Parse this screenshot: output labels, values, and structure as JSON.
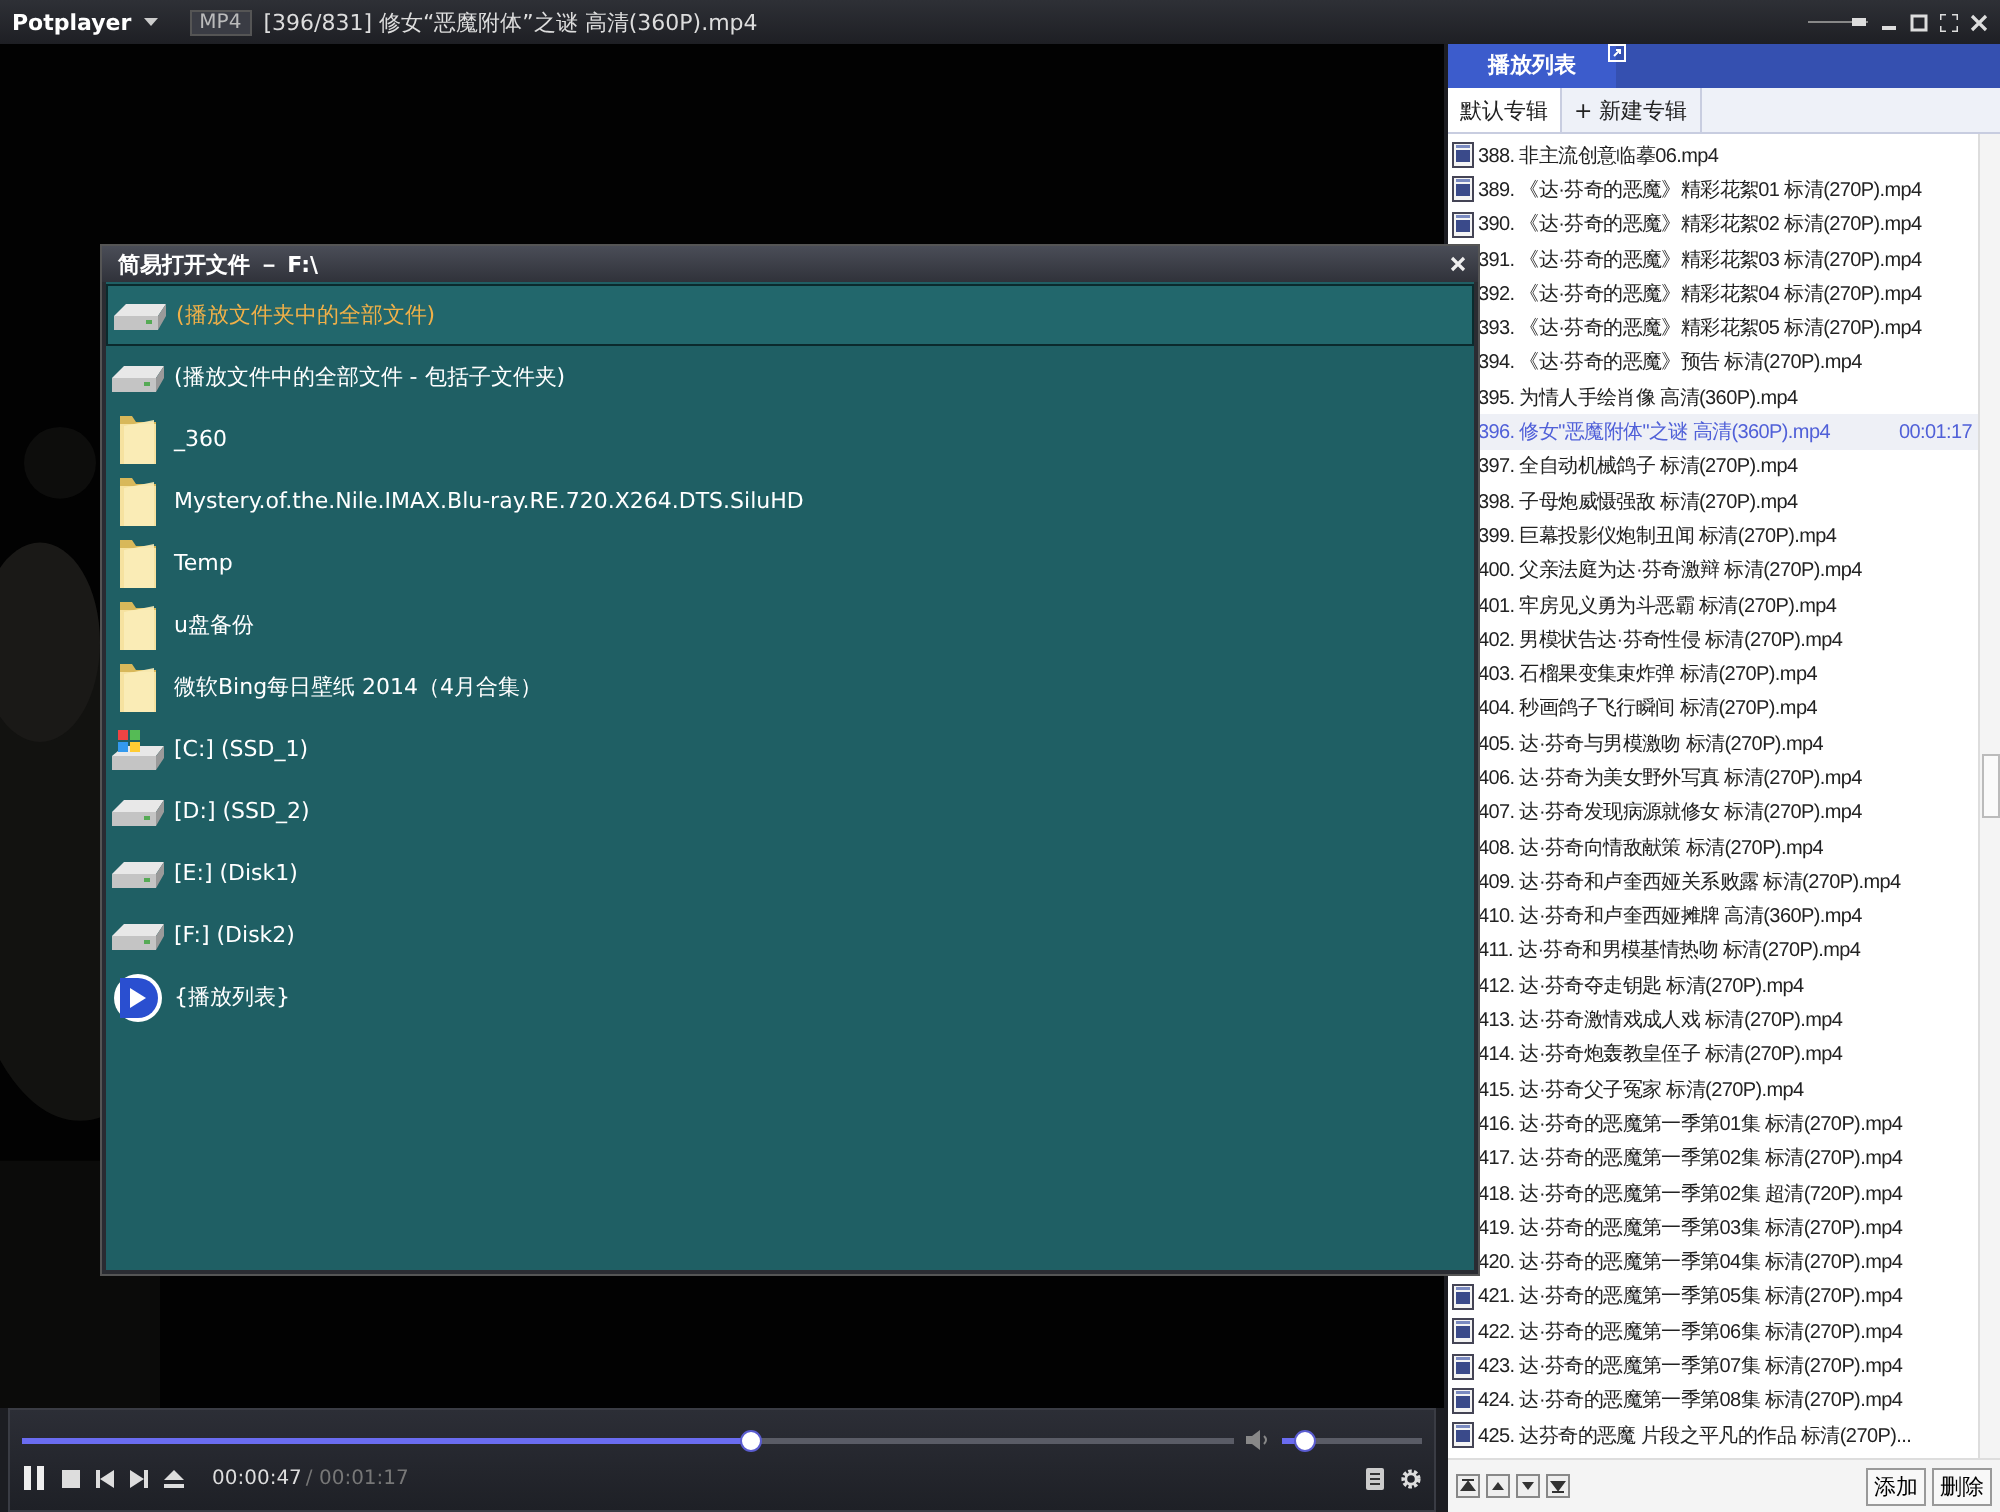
{
  "titlebar": {
    "logo": "Potplayer",
    "format": "MP4",
    "title": "[396/831] 修女“恶魔附体”之谜 高清(360P).mp4"
  },
  "playlist": {
    "title": "播放列表",
    "tabs": [
      {
        "label": "默认专辑",
        "selected": true
      },
      {
        "label": "+ 新建专辑",
        "selected": false
      }
    ],
    "rows": [
      {
        "text": "388. 非主流创意临摹06.mp4",
        "icon": true,
        "selected": false
      },
      {
        "text": "389. 《达·芬奇的恶魔》精彩花絮01 标清(270P).mp4",
        "icon": true,
        "selected": false
      },
      {
        "text": "390. 《达·芬奇的恶魔》精彩花絮02 标清(270P).mp4",
        "icon": true,
        "selected": false
      },
      {
        "text": "391. 《达·芬奇的恶魔》精彩花絮03 标清(270P).mp4",
        "icon": false,
        "selected": false
      },
      {
        "text": "392. 《达·芬奇的恶魔》精彩花絮04 标清(270P).mp4",
        "icon": false,
        "selected": false
      },
      {
        "text": "393. 《达·芬奇的恶魔》精彩花絮05 标清(270P).mp4",
        "icon": false,
        "selected": false
      },
      {
        "text": "394. 《达·芬奇的恶魔》预告 标清(270P).mp4",
        "icon": false,
        "selected": false
      },
      {
        "text": "395. 为情人手绘肖像 高清(360P).mp4",
        "icon": false,
        "selected": false
      },
      {
        "text": "396. 修女\"恶魔附体\"之谜 高清(360P).mp4",
        "duration": "00:01:17",
        "icon": false,
        "selected": true
      },
      {
        "text": "397. 全自动机械鸽子 标清(270P).mp4",
        "icon": false,
        "selected": false
      },
      {
        "text": "398. 子母炮威慑强敌 标清(270P).mp4",
        "icon": false,
        "selected": false
      },
      {
        "text": "399. 巨幕投影仪炮制丑闻 标清(270P).mp4",
        "icon": false,
        "selected": false
      },
      {
        "text": "400. 父亲法庭为达·芬奇激辩 标清(270P).mp4",
        "icon": false,
        "selected": false
      },
      {
        "text": "401. 牢房见义勇为斗恶霸 标清(270P).mp4",
        "icon": false,
        "selected": false
      },
      {
        "text": "402. 男模状告达·芬奇性侵 标清(270P).mp4",
        "icon": false,
        "selected": false
      },
      {
        "text": "403. 石榴果变集束炸弹 标清(270P).mp4",
        "icon": false,
        "selected": false
      },
      {
        "text": "404. 秒画鸽子飞行瞬间 标清(270P).mp4",
        "icon": false,
        "selected": false
      },
      {
        "text": "405. 达·芬奇与男模激吻 标清(270P).mp4",
        "icon": false,
        "selected": false
      },
      {
        "text": "406. 达·芬奇为美女野外写真 标清(270P).mp4",
        "icon": false,
        "selected": false
      },
      {
        "text": "407. 达·芬奇发现病源就修女 标清(270P).mp4",
        "icon": false,
        "selected": false
      },
      {
        "text": "408. 达·芬奇向情敌献策 标清(270P).mp4",
        "icon": false,
        "selected": false
      },
      {
        "text": "409. 达·芬奇和卢奎西娅关系败露 标清(270P).mp4",
        "icon": false,
        "selected": false
      },
      {
        "text": "410. 达·芬奇和卢奎西娅摊牌 高清(360P).mp4",
        "icon": false,
        "selected": false
      },
      {
        "text": "411. 达·芬奇和男模基情热吻 标清(270P).mp4",
        "icon": false,
        "selected": false
      },
      {
        "text": "412. 达·芬奇夺走钥匙 标清(270P).mp4",
        "icon": false,
        "selected": false
      },
      {
        "text": "413. 达·芬奇激情戏成人戏 标清(270P).mp4",
        "icon": false,
        "selected": false
      },
      {
        "text": "414. 达·芬奇炮轰教皇侄子 标清(270P).mp4",
        "icon": false,
        "selected": false
      },
      {
        "text": "415. 达·芬奇父子冤家 标清(270P).mp4",
        "icon": false,
        "selected": false
      },
      {
        "text": "416. 达·芬奇的恶魔第一季第01集 标清(270P).mp4",
        "icon": false,
        "selected": false
      },
      {
        "text": "417. 达·芬奇的恶魔第一季第02集 标清(270P).mp4",
        "icon": false,
        "selected": false
      },
      {
        "text": "418. 达·芬奇的恶魔第一季第02集 超清(720P).mp4",
        "icon": false,
        "selected": false
      },
      {
        "text": "419. 达·芬奇的恶魔第一季第03集 标清(270P).mp4",
        "icon": false,
        "selected": false
      },
      {
        "text": "420. 达·芬奇的恶魔第一季第04集 标清(270P).mp4",
        "icon": false,
        "selected": false
      },
      {
        "text": "421. 达·芬奇的恶魔第一季第05集 标清(270P).mp4",
        "icon": true,
        "selected": false
      },
      {
        "text": "422. 达·芬奇的恶魔第一季第06集 标清(270P).mp4",
        "icon": true,
        "selected": false
      },
      {
        "text": "423. 达·芬奇的恶魔第一季第07集 标清(270P).mp4",
        "icon": true,
        "selected": false
      },
      {
        "text": "424. 达·芬奇的恶魔第一季第08集 标清(270P).mp4",
        "icon": true,
        "selected": false
      },
      {
        "text": "425. 达芬奇的恶魔 片段之平凡的作品 标清(270P)...",
        "icon": true,
        "selected": false
      }
    ],
    "buttons": [
      "添加",
      "删除"
    ]
  },
  "dialog": {
    "title": "简易打开文件 － F:\\",
    "items": [
      {
        "kind": "drive",
        "label": "(播放文件夹中的全部文件)",
        "selected": true
      },
      {
        "kind": "drive",
        "label": "(播放文件中的全部文件 - 包括子文件夹)",
        "selected": false
      },
      {
        "kind": "folder",
        "label": "_360",
        "selected": false
      },
      {
        "kind": "folder",
        "label": "Mystery.of.the.Nile.IMAX.Blu-ray.RE.720.X264.DTS.SiluHD",
        "selected": false
      },
      {
        "kind": "folder",
        "label": "Temp",
        "selected": false
      },
      {
        "kind": "folder",
        "label": "u盘备份",
        "selected": false
      },
      {
        "kind": "folder",
        "label": "微软Bing每日壁纸 2014（4月合集）",
        "selected": false
      },
      {
        "kind": "system",
        "label": "[C:] (SSD_1)",
        "selected": false
      },
      {
        "kind": "drive",
        "label": "[D:] (SSD_2)",
        "selected": false
      },
      {
        "kind": "drive",
        "label": "[E:] (Disk1)",
        "selected": false
      },
      {
        "kind": "drive",
        "label": "[F:] (Disk2)",
        "selected": false
      },
      {
        "kind": "playlist",
        "label": "{播放列表}",
        "selected": false
      }
    ]
  },
  "controls": {
    "seek": {
      "level": 0.6
    },
    "volume": {
      "level": 0.15
    },
    "elapsed": "00:00:47",
    "total": "/ 00:01:17"
  }
}
